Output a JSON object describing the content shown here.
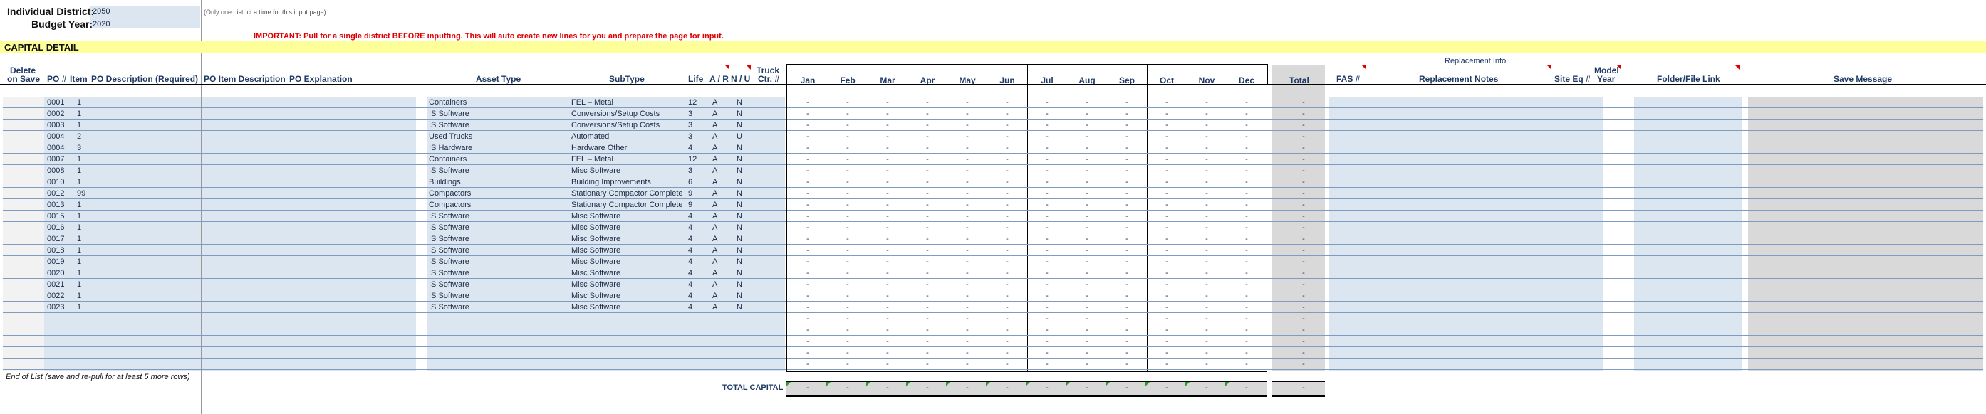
{
  "header": {
    "district_label": "Individual District:",
    "district_value": "2050",
    "budget_label": "Budget Year:",
    "budget_value": "2020",
    "district_note": "(Only one district a time for this input page)",
    "important_note": "IMPORTANT:  Pull for a single district BEFORE inputting.  This will auto create new lines for you and prepare the page for input."
  },
  "section_title": "CAPITAL DETAIL",
  "replacement_group": "Replacement Info",
  "columns": {
    "delete": "Delete",
    "on_save": "on Save",
    "po": "PO #",
    "item": "Item",
    "po_desc": "PO Description (Required)",
    "po_item_desc": "PO Item Description",
    "po_expl": "PO Explanation",
    "asset_type": "Asset Type",
    "subtype": "SubType",
    "life": "Life",
    "ar": "A / R",
    "nu": "N / U",
    "truck1": "Truck",
    "truck2": "Ctr. #",
    "months": [
      "Jan",
      "Feb",
      "Mar",
      "Apr",
      "May",
      "Jun",
      "Jul",
      "Aug",
      "Sep",
      "Oct",
      "Nov",
      "Dec"
    ],
    "total": "Total",
    "fas": "FAS #",
    "repl_notes": "Replacement Notes",
    "site_eq": "Site Eq #",
    "model1": "Model",
    "model2": "Year",
    "folder": "Folder/File Link",
    "save_msg": "Save Message"
  },
  "rows": [
    {
      "po": "0001",
      "item": "1",
      "asset": "Containers",
      "subtype": "FEL – Metal",
      "life": "12",
      "ar": "A",
      "nu": "N"
    },
    {
      "po": "0002",
      "item": "1",
      "asset": "IS Software",
      "subtype": "Conversions/Setup Costs",
      "life": "3",
      "ar": "A",
      "nu": "N"
    },
    {
      "po": "0003",
      "item": "1",
      "asset": "IS Software",
      "subtype": "Conversions/Setup Costs",
      "life": "3",
      "ar": "A",
      "nu": "N"
    },
    {
      "po": "0004",
      "item": "2",
      "asset": "Used Trucks",
      "subtype": "Automated",
      "life": "3",
      "ar": "A",
      "nu": "U"
    },
    {
      "po": "0004",
      "item": "3",
      "asset": "IS Hardware",
      "subtype": "Hardware Other",
      "life": "4",
      "ar": "A",
      "nu": "N"
    },
    {
      "po": "0007",
      "item": "1",
      "asset": "Containers",
      "subtype": "FEL – Metal",
      "life": "12",
      "ar": "A",
      "nu": "N"
    },
    {
      "po": "0008",
      "item": "1",
      "asset": "IS Software",
      "subtype": "Misc Software",
      "life": "3",
      "ar": "A",
      "nu": "N"
    },
    {
      "po": "0010",
      "item": "1",
      "asset": "Buildings",
      "subtype": "Building Improvements",
      "life": "6",
      "ar": "A",
      "nu": "N"
    },
    {
      "po": "0012",
      "item": "99",
      "asset": "Compactors",
      "subtype": "Stationary Compactor Complete",
      "life": "9",
      "ar": "A",
      "nu": "N"
    },
    {
      "po": "0013",
      "item": "1",
      "asset": "Compactors",
      "subtype": "Stationary Compactor Complete",
      "life": "9",
      "ar": "A",
      "nu": "N"
    },
    {
      "po": "0015",
      "item": "1",
      "asset": "IS Software",
      "subtype": "Misc Software",
      "life": "4",
      "ar": "A",
      "nu": "N"
    },
    {
      "po": "0016",
      "item": "1",
      "asset": "IS Software",
      "subtype": "Misc Software",
      "life": "4",
      "ar": "A",
      "nu": "N"
    },
    {
      "po": "0017",
      "item": "1",
      "asset": "IS Software",
      "subtype": "Misc Software",
      "life": "4",
      "ar": "A",
      "nu": "N"
    },
    {
      "po": "0018",
      "item": "1",
      "asset": "IS Software",
      "subtype": "Misc Software",
      "life": "4",
      "ar": "A",
      "nu": "N"
    },
    {
      "po": "0019",
      "item": "1",
      "asset": "IS Software",
      "subtype": "Misc Software",
      "life": "4",
      "ar": "A",
      "nu": "N"
    },
    {
      "po": "0020",
      "item": "1",
      "asset": "IS Software",
      "subtype": "Misc Software",
      "life": "4",
      "ar": "A",
      "nu": "N"
    },
    {
      "po": "0021",
      "item": "1",
      "asset": "IS Software",
      "subtype": "Misc Software",
      "life": "4",
      "ar": "A",
      "nu": "N"
    },
    {
      "po": "0022",
      "item": "1",
      "asset": "IS Software",
      "subtype": "Misc Software",
      "life": "4",
      "ar": "A",
      "nu": "N"
    },
    {
      "po": "0023",
      "item": "1",
      "asset": "IS Software",
      "subtype": "Misc Software",
      "life": "4",
      "ar": "A",
      "nu": "N"
    },
    {
      "po": "",
      "item": "",
      "asset": "",
      "subtype": "",
      "life": "",
      "ar": "",
      "nu": ""
    },
    {
      "po": "",
      "item": "",
      "asset": "",
      "subtype": "",
      "life": "",
      "ar": "",
      "nu": ""
    },
    {
      "po": "",
      "item": "",
      "asset": "",
      "subtype": "",
      "life": "",
      "ar": "",
      "nu": ""
    },
    {
      "po": "",
      "item": "",
      "asset": "",
      "subtype": "",
      "life": "",
      "ar": "",
      "nu": ""
    },
    {
      "po": "",
      "item": "",
      "asset": "",
      "subtype": "",
      "life": "",
      "ar": "",
      "nu": ""
    }
  ],
  "dash": "-",
  "end_of_list": "End of List (save and re-pull for at least 5 more rows)",
  "total_capital_label": "TOTAL CAPITAL",
  "colors": {
    "input_bg": "#dce6f1",
    "grey_bg": "#d9d9d9",
    "title_bg": "#ffff99",
    "important_red": "#e00000"
  }
}
